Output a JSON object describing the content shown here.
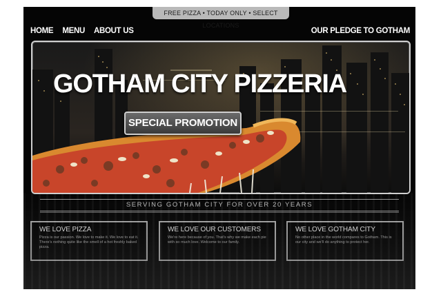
{
  "promo_bar": {
    "text": "FREE PIZZA • TODAY ONLY • SELECT LOCATIONS"
  },
  "nav": {
    "items": [
      {
        "label": "HOME"
      },
      {
        "label": "MENU"
      },
      {
        "label": "ABOUT US"
      }
    ],
    "pledge_label": "OUR PLEDGE TO GOTHAM"
  },
  "hero": {
    "title": "GOTHAM CITY PIZZERIA",
    "button_label": "SPECIAL PROMOTION"
  },
  "tagline": "SERVING GOTHAM CITY FOR OVER 20 YEARS",
  "cards": [
    {
      "title": "WE LOVE PIZZA",
      "body": "Pizza is our passion. We love to make it. We love to eat it. There's nothing quite like the smell of a hot freshly baked pizza."
    },
    {
      "title": "WE LOVE OUR CUSTOMERS",
      "body": "We're here because of you. That's why we make each pie with so much love. Welcome to our family."
    },
    {
      "title": "WE LOVE GOTHAM CITY",
      "body": "No other place in the world compares to Gotham. This is our city and we'll do anything to protect her."
    }
  ],
  "colors": {
    "background": "#050505",
    "text": "#ffffff",
    "frame": "#cfcfcf",
    "promo_pill": "#b9b9b9"
  }
}
